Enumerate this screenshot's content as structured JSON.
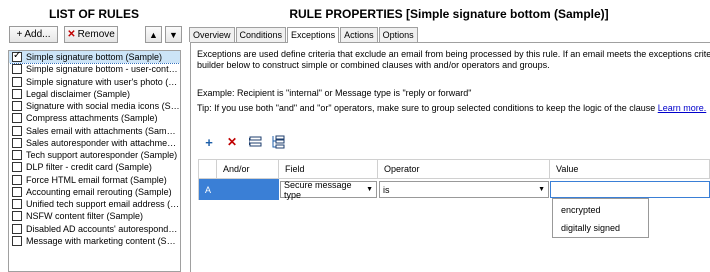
{
  "left": {
    "title": "LIST OF RULES",
    "add_label": "Add...",
    "remove_label": "Remove",
    "rules": [
      {
        "label": "Simple signature bottom (Sample)",
        "checked": true,
        "selected": true
      },
      {
        "label": "Simple signature bottom - user-controlle...",
        "checked": false
      },
      {
        "label": "Simple signature with user's photo (Sam...",
        "checked": false
      },
      {
        "label": "Legal disclaimer (Sample)",
        "checked": false
      },
      {
        "label": "Signature with social media icons (Sam...",
        "checked": false
      },
      {
        "label": "Compress attachments (Sample)",
        "checked": false
      },
      {
        "label": "Sales email with attachments (Sample)",
        "checked": false
      },
      {
        "label": "Sales autoresponder with attachments (...",
        "checked": false
      },
      {
        "label": "Tech support autoresponder (Sample)",
        "checked": false
      },
      {
        "label": "DLP filter - credit card (Sample)",
        "checked": false
      },
      {
        "label": "Force HTML email format (Sample)",
        "checked": false
      },
      {
        "label": "Accounting email rerouting (Sample)",
        "checked": false
      },
      {
        "label": "Unified tech support email address (Sa...",
        "checked": false
      },
      {
        "label": "NSFW content filter (Sample)",
        "checked": false
      },
      {
        "label": "Disabled AD accounts' autoresponder (...",
        "checked": false
      },
      {
        "label": "Message with marketing content (Sampl...",
        "checked": false
      }
    ]
  },
  "right": {
    "title": "RULE PROPERTIES [Simple signature bottom (Sample)]",
    "tabs": [
      "Overview",
      "Conditions",
      "Exceptions",
      "Actions",
      "Options"
    ],
    "active_tab": "Exceptions",
    "description_line1": "Exceptions are used define criteria that exclude an email from being processed by this rule. If an email meets the exceptions criteria it will not",
    "description_line2": "builder below to construct simple or combined clauses with and/or operators and groups.",
    "example": "Example: Recipient is \"internal\" or Message type is \"reply or forward\"",
    "tip": "Tip: If you use both \"and\" and \"or\" operators, make sure to group selected conditions to keep the logic of the clause",
    "tip_link": "Learn more.",
    "grid": {
      "headers": [
        "",
        "And/or",
        "Field",
        "Operator",
        "Value"
      ],
      "row": {
        "id": "A",
        "andor": "",
        "field": "Secure message type",
        "operator": "is",
        "value": ""
      }
    },
    "value_options": [
      "encrypted",
      "digitally signed"
    ]
  }
}
